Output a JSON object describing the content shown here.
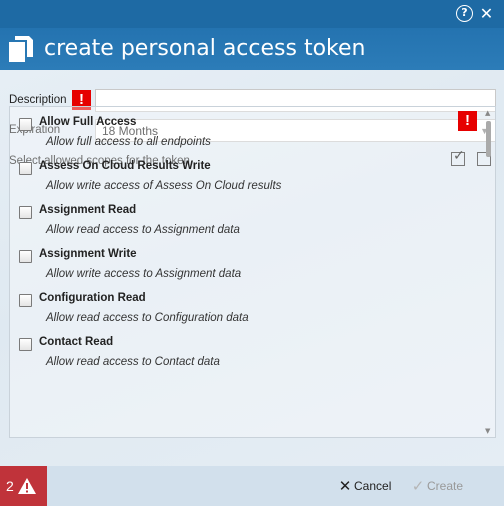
{
  "window": {
    "title": "create personal access token",
    "help_icon": "help-icon",
    "close_icon": "close-icon"
  },
  "form": {
    "description_label": "Description",
    "description_value": "",
    "description_error": "!",
    "expiration_label": "Expiration",
    "expiration_value": "18 Months",
    "scopes_label": "Select allowed scopes for the token",
    "scopes_error": "!"
  },
  "scopes": [
    {
      "title": "Allow Full Access",
      "desc": "Allow full access to all endpoints",
      "checked": false
    },
    {
      "title": "Assess On Cloud Results Write",
      "desc": "Allow write access of Assess On Cloud results",
      "checked": false
    },
    {
      "title": "Assignment Read",
      "desc": "Allow read access to Assignment data",
      "checked": false
    },
    {
      "title": "Assignment Write",
      "desc": "Allow write access to Assignment data",
      "checked": false
    },
    {
      "title": "Configuration Read",
      "desc": "Allow read access to Configuration data",
      "checked": false
    },
    {
      "title": "Contact Read",
      "desc": "Allow read access to Contact data",
      "checked": false
    }
  ],
  "footer": {
    "error_count": "2",
    "cancel_label": "Cancel",
    "create_label": "Create"
  },
  "colors": {
    "header": "#2473b0",
    "error": "#e60000",
    "footer_error": "#c0333a"
  }
}
